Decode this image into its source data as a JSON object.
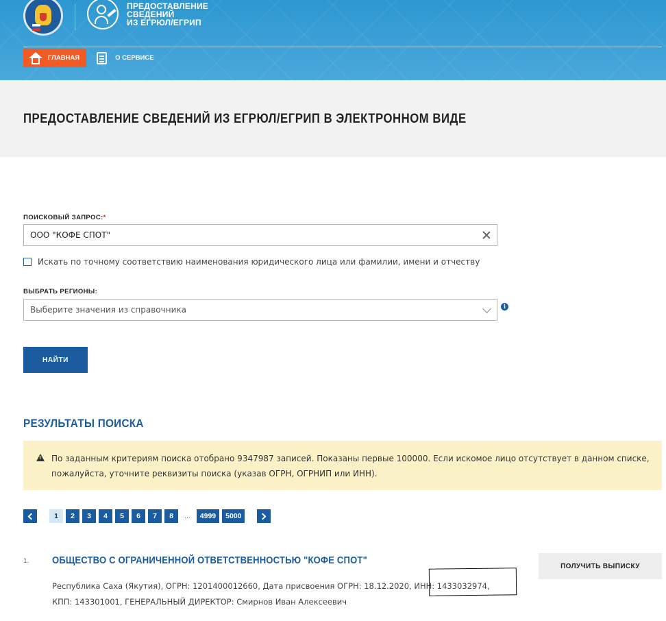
{
  "header": {
    "service_title_line1": "ПРЕДОСТАВЛЕНИЕ",
    "service_title_line2": "СВЕДЕНИЙ",
    "service_title_line3": "ИЗ ЕГРЮЛ/ЕГРИП",
    "nav": {
      "home_label": "ГЛАВНАЯ",
      "about_label": "О СЕРВИСЕ"
    },
    "colors": {
      "header_blue": "#2d97d1",
      "nav_active": "#f15a24"
    }
  },
  "banner": {
    "title": "ПРЕДОСТАВЛЕНИЕ СВЕДЕНИЙ ИЗ ЕГРЮЛ/ЕГРИП В ЭЛЕКТРОННОМ ВИДЕ"
  },
  "form": {
    "query_label": "ПОИСКОВЫЙ ЗАПРОС:",
    "required_mark": "*",
    "query_value": "ООО \"КОФЕ СПОТ\"",
    "exact_match_label": "Искать по точному соответствию наименования юридического лица или фамилии, имени и отчеству",
    "exact_match_checked": false,
    "regions_label": "ВЫБРАТЬ РЕГИОНЫ:",
    "regions_placeholder": "Выберите значения из справочника",
    "submit_label": "НАЙТИ",
    "icons": {
      "clear": "close-icon",
      "dropdown": "chevron-down-icon",
      "info": "info-icon"
    }
  },
  "results": {
    "title": "РЕЗУЛЬТАТЫ ПОИСКА",
    "warning_text": "По заданным критериям поиска отобрано 9347987 записей. Показаны первые 100000. Если искомое лицо отсутствует в данном списке, пожалуйста, уточните реквизиты поиска (указав ОГРН, ОГРНИП или ИНН).",
    "pagination": {
      "pages": [
        "1",
        "2",
        "3",
        "4",
        "5",
        "6",
        "7",
        "8"
      ],
      "active_page": "1",
      "ellipsis": "...",
      "last_pages": [
        "4999",
        "5000"
      ]
    },
    "items": [
      {
        "number": "1.",
        "name": "ОБЩЕСТВО С ОГРАНИЧЕННОЙ ОТВЕТСТВЕННОСТЬЮ \"КОФЕ СПОТ\"",
        "details_line1": "Республика Саха (Якутия), ОГРН: 1201400012660, Дата присвоения ОГРН: 18.12.2020, ИНН: 1433032974,",
        "details_line2": "КПП: 143301001, ГЕНЕРАЛЬНЫЙ ДИРЕКТОР: Смирнов Иван Алексеевич",
        "action_label": "ПОЛУЧИТЬ ВЫПИСКУ"
      }
    ]
  }
}
